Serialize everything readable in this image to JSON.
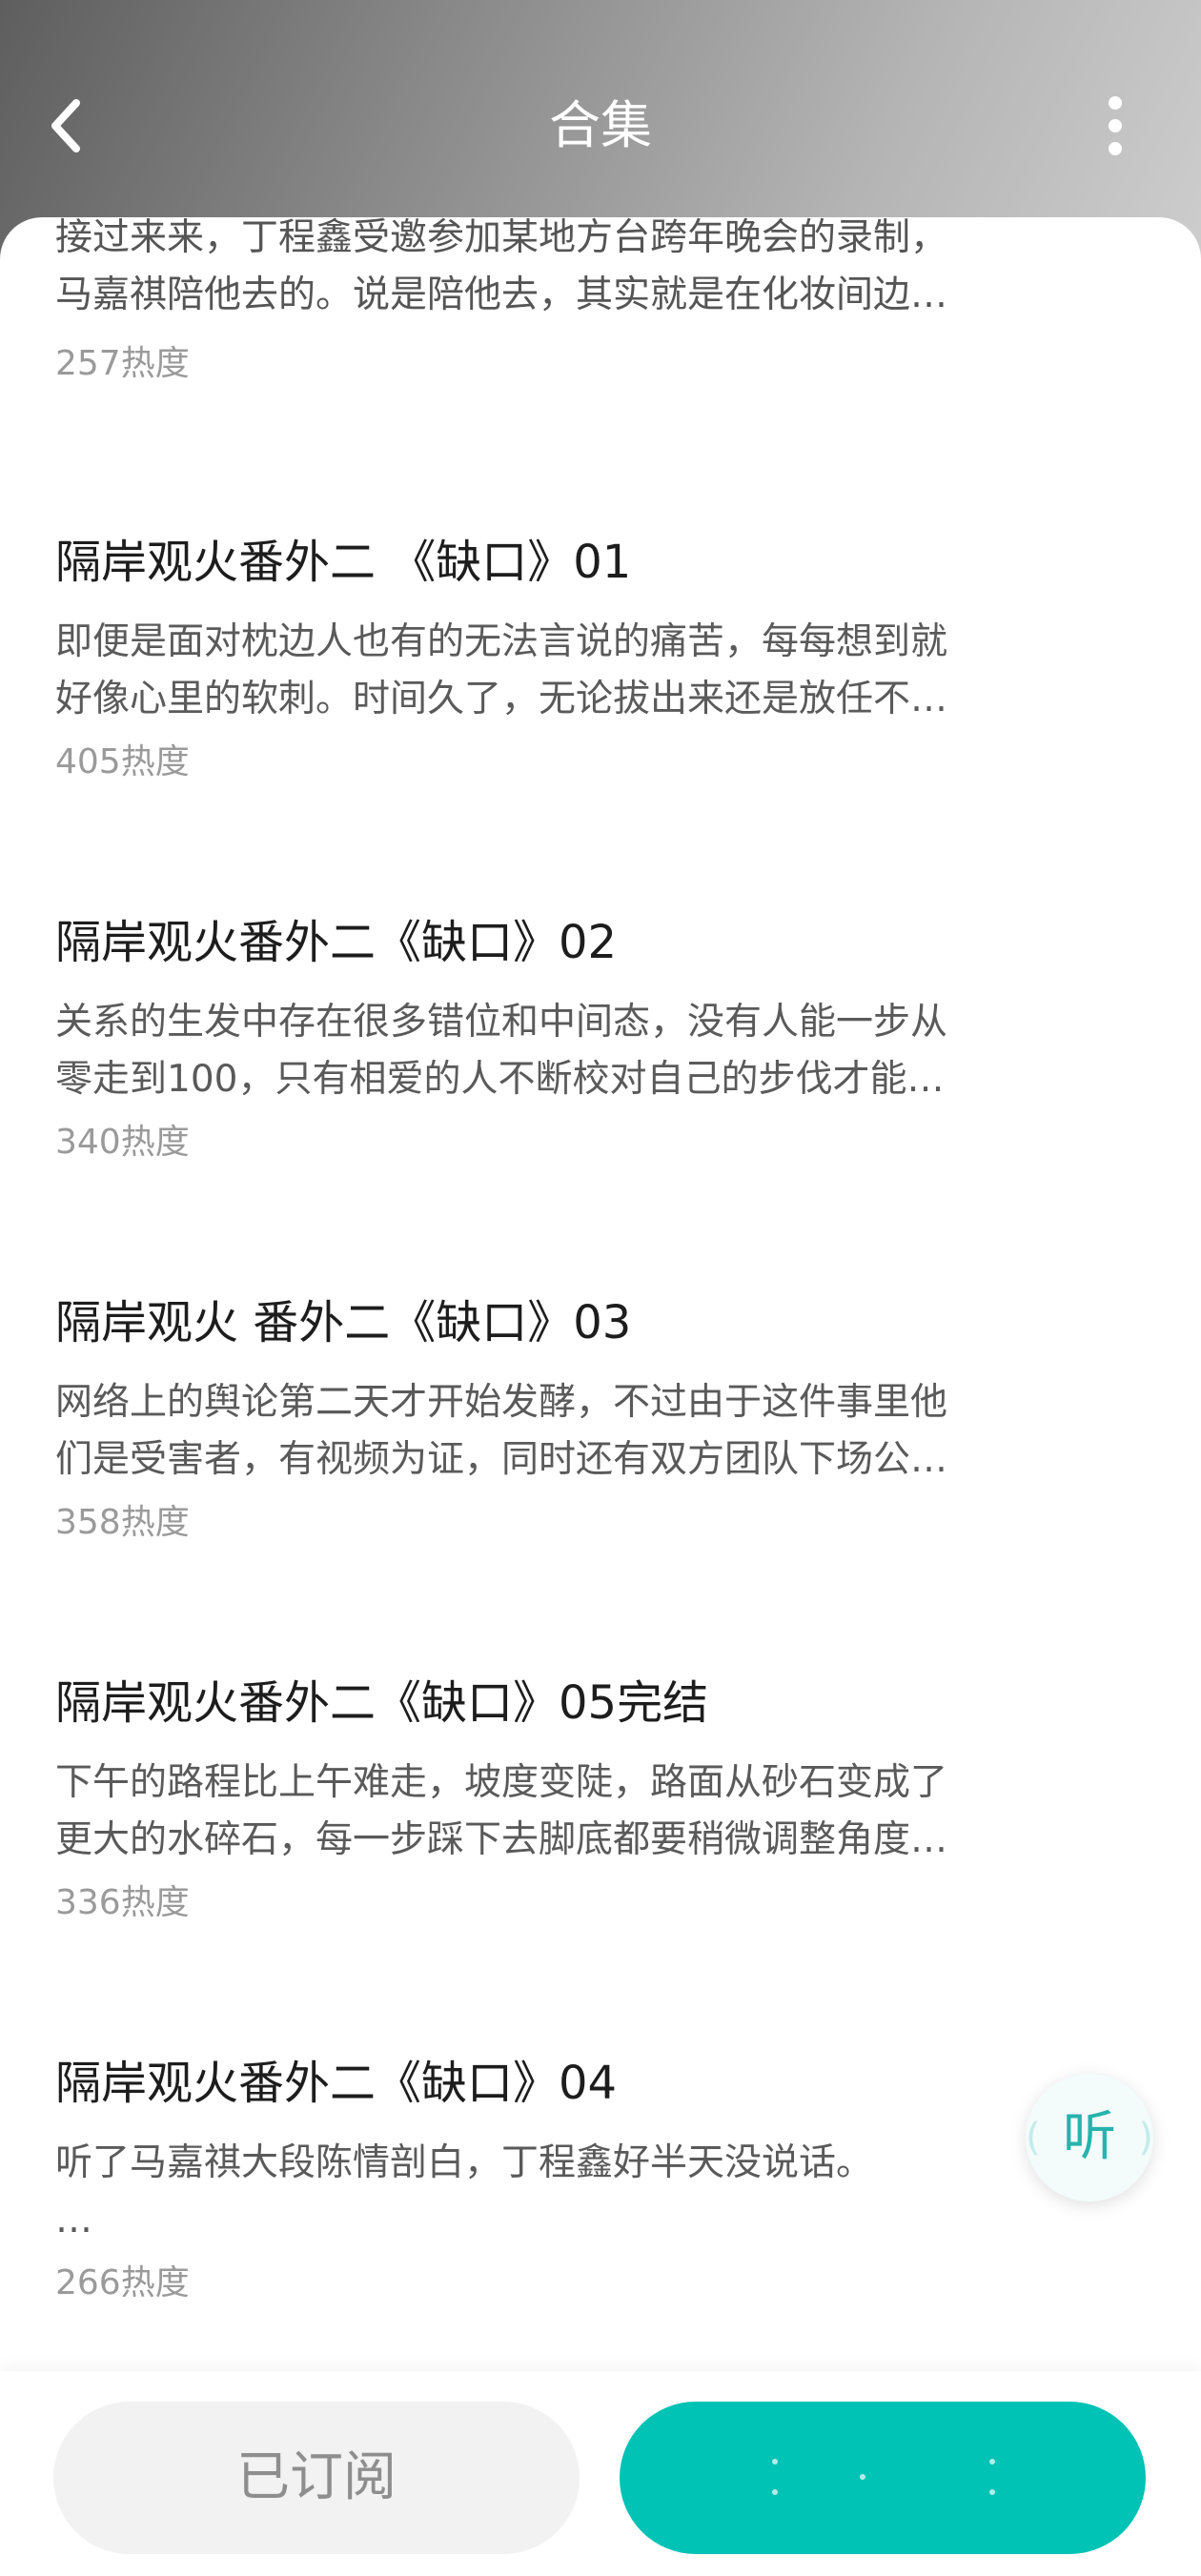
{
  "header": {
    "title": "合集"
  },
  "partial_entry": {
    "desc_top": "接过来来，丁程鑫受邀参加某地方台跨年晚会的录制，",
    "desc_bottom": "马嘉祺陪他去的。说是陪他去，其实就是在化妆间边…",
    "heat": "257热度"
  },
  "entries": [
    {
      "title": "隔岸观火番外二 《缺口》01",
      "desc_line1": "即便是面对枕边人也有的无法言说的痛苦，每每想到就",
      "desc_line2": "好像心里的软刺。时间久了，无论拔出来还是放任不…",
      "heat": "405热度"
    },
    {
      "title": "隔岸观火番外二《缺口》02",
      "desc_line1": "关系的生发中存在很多错位和中间态，没有人能一步从",
      "desc_line2": "零走到100，只有相爱的人不断校对自己的步伐才能…",
      "heat": "340热度"
    },
    {
      "title": "隔岸观火 番外二《缺口》03",
      "desc_line1": "网络上的舆论第二天才开始发酵，不过由于这件事里他",
      "desc_line2": "们是受害者，有视频为证，同时还有双方团队下场公…",
      "heat": "358热度"
    },
    {
      "title": "隔岸观火番外二《缺口》05完结",
      "desc_line1": "下午的路程比上午难走，坡度变陡，路面从砂石变成了",
      "desc_line2": "更大的水碎石，每一步踩下去脚底都要稍微调整角度…",
      "heat": "336热度"
    },
    {
      "title": "隔岸观火番外二《缺口》04",
      "desc_line1": "听了马嘉祺大段陈情剖白，丁程鑫好半天没说话。",
      "desc_line2": "…",
      "heat": "266热度"
    }
  ],
  "floating": {
    "listen_label": "听"
  },
  "bottom": {
    "subscribed_label": "已订阅"
  },
  "colors": {
    "accent": "#00c2b5",
    "listen_text": "#27b3ad"
  }
}
